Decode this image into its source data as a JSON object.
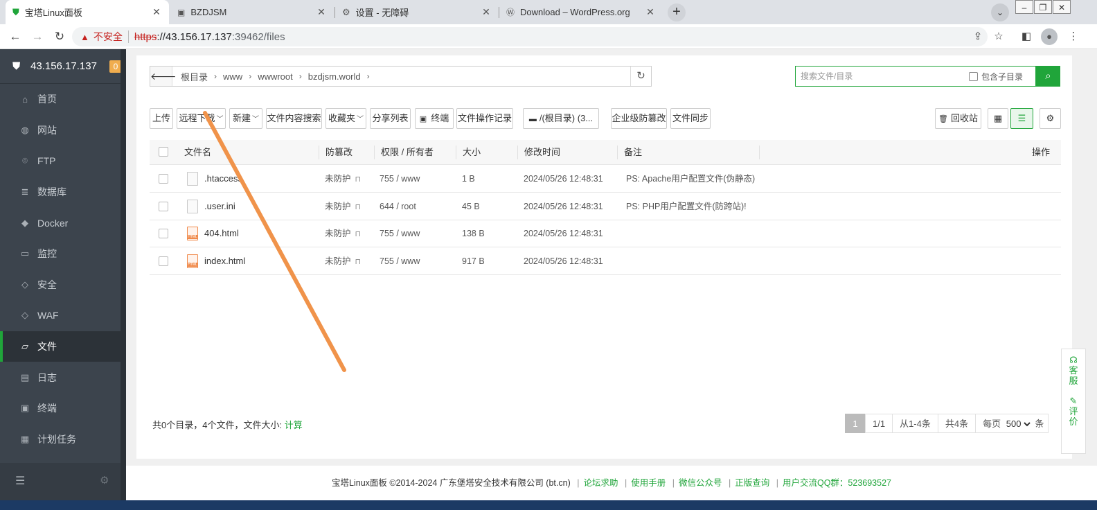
{
  "browser": {
    "tabs": [
      {
        "title": "宝塔Linux面板",
        "active": true
      },
      {
        "title": "BZDJSM",
        "active": false
      },
      {
        "title": "设置 - 无障碍",
        "active": false
      },
      {
        "title": "Download – WordPress.org",
        "active": false
      }
    ],
    "tab_close": "✕",
    "new_tab": "+",
    "address": {
      "security_label": "不安全",
      "scheme": "https",
      "host": "://43.156.17.137",
      "rest": ":39462/files"
    }
  },
  "sidebar": {
    "server_ip": "43.156.17.137",
    "badge": "0",
    "items": [
      {
        "label": "首页",
        "icon": "home-icon",
        "glyph": "⌂",
        "active": false
      },
      {
        "label": "网站",
        "icon": "globe-icon",
        "glyph": "◍",
        "active": false
      },
      {
        "label": "FTP",
        "icon": "ftp-icon",
        "glyph": "⌾",
        "active": false
      },
      {
        "label": "数据库",
        "icon": "database-icon",
        "glyph": "≣",
        "active": false
      },
      {
        "label": "Docker",
        "icon": "docker-icon",
        "glyph": "◆",
        "active": false
      },
      {
        "label": "监控",
        "icon": "monitor-icon",
        "glyph": "▭",
        "active": false
      },
      {
        "label": "安全",
        "icon": "shield-icon",
        "glyph": "◇",
        "active": false
      },
      {
        "label": "WAF",
        "icon": "waf-shield-icon",
        "glyph": "◇",
        "active": false
      },
      {
        "label": "文件",
        "icon": "folder-icon",
        "glyph": "▱",
        "active": true
      },
      {
        "label": "日志",
        "icon": "log-icon",
        "glyph": "▤",
        "active": false
      },
      {
        "label": "终端",
        "icon": "terminal-icon",
        "glyph": "▣",
        "active": false
      },
      {
        "label": "计划任务",
        "icon": "calendar-icon",
        "glyph": "▦",
        "active": false
      }
    ]
  },
  "breadcrumb": [
    "根目录",
    "www",
    "wwwroot",
    "bzdjsm.world"
  ],
  "search": {
    "placeholder": "搜索文件/目录",
    "subdir_label": "包含子目录"
  },
  "actions": {
    "upload": "上传",
    "remote_download": "远程下载",
    "new": "新建",
    "content_search": "文件内容搜索",
    "favorites": "收藏夹",
    "share_list": "分享列表",
    "terminal": "终端",
    "op_log": "文件操作记录",
    "disk": "/(根目录) (3...",
    "tamper": "企业级防篡改",
    "sync": "文件同步",
    "recycle": "回收站"
  },
  "table": {
    "headers": {
      "name": "文件名",
      "protect": "防篡改",
      "perm": "权限 / 所有者",
      "size": "大小",
      "mtime": "修改时间",
      "note": "备注",
      "ops": "操作"
    },
    "rows": [
      {
        "name": ".htaccess",
        "type": "text",
        "protect": "未防护",
        "perm": "755 / www",
        "size": "1 B",
        "mtime": "2024/05/26 12:48:31",
        "note": "PS: Apache用户配置文件(伪静态)"
      },
      {
        "name": ".user.ini",
        "type": "text",
        "protect": "未防护",
        "perm": "644 / root",
        "size": "45 B",
        "mtime": "2024/05/26 12:48:31",
        "note": "PS: PHP用户配置文件(防跨站)!"
      },
      {
        "name": "404.html",
        "type": "html",
        "protect": "未防护",
        "perm": "755 / www",
        "size": "138 B",
        "mtime": "2024/05/26 12:48:31",
        "note": ""
      },
      {
        "name": "index.html",
        "type": "html",
        "protect": "未防护",
        "perm": "755 / www",
        "size": "917 B",
        "mtime": "2024/05/26 12:48:31",
        "note": ""
      }
    ]
  },
  "summary": {
    "text": "共0个目录，4个文件，文件大小:",
    "calc": "计算"
  },
  "pager": {
    "current": "1",
    "pages": "1/1",
    "range": "从1-4条",
    "total": "共4条",
    "per_page_label": "每页",
    "per_page": "500",
    "unit": "条"
  },
  "footer": {
    "copyright": "宝塔Linux面板 ©2014-2024 广东堡塔安全技术有限公司 (bt.cn)",
    "links": [
      "论坛求助",
      "使用手册",
      "微信公众号",
      "正版查询",
      "用户交流QQ群：523693527"
    ]
  },
  "help_float": {
    "service": "客服",
    "review": "评价"
  },
  "annotation": {
    "color": "#f0934a"
  }
}
